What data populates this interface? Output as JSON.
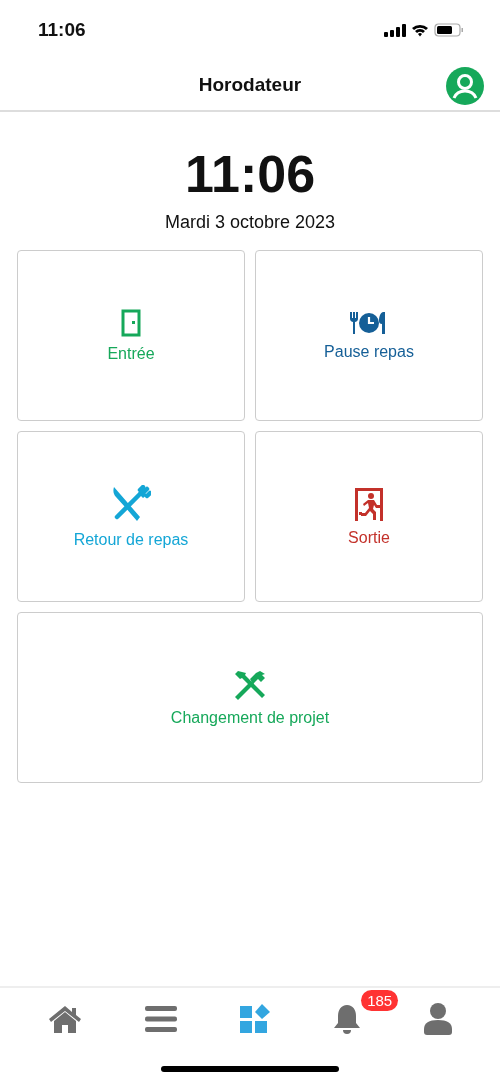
{
  "status_bar": {
    "time": "11:06"
  },
  "nav": {
    "title": "Horodateur"
  },
  "clock": {
    "time": "11:06",
    "date": "Mardi 3 octobre 2023"
  },
  "actions": [
    {
      "kind": "door",
      "label": "Entrée",
      "color": "#16a85a"
    },
    {
      "kind": "meal",
      "label": "Pause repas",
      "color": "#155f97"
    },
    {
      "kind": "cutlery",
      "label": "Retour de repas",
      "color": "#14a6d6"
    },
    {
      "kind": "exit",
      "label": "Sortie",
      "color": "#c3312a"
    },
    {
      "kind": "tools",
      "label": "Changement de projet",
      "color": "#16a85a"
    }
  ],
  "tab_bar": [
    {
      "kind": "home",
      "selected": false
    },
    {
      "kind": "menu",
      "selected": false
    },
    {
      "kind": "apps",
      "selected": true
    },
    {
      "kind": "bell",
      "selected": false,
      "badge": "185"
    },
    {
      "kind": "user",
      "selected": false
    }
  ]
}
